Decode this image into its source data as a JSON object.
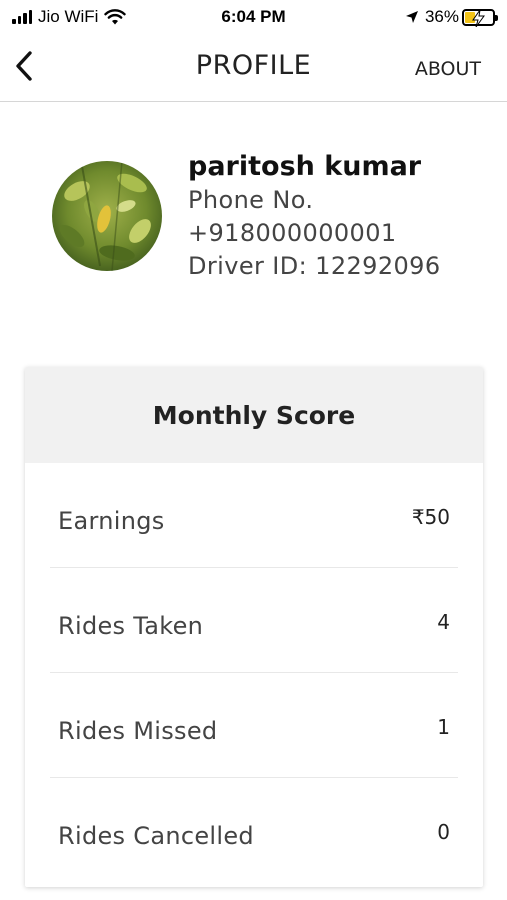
{
  "status_bar": {
    "carrier": "Jio WiFi",
    "time": "6:04 PM",
    "battery_percent": "36%",
    "battery_level": 0.36,
    "battery_color": "#f2c318"
  },
  "nav": {
    "back_icon": "chevron-left-icon",
    "title": "PROFILE",
    "about_label": "ABOUT"
  },
  "profile": {
    "name": "paritosh kumar",
    "phone_label": "Phone No.",
    "phone": "+918000000001",
    "driver_id": "Driver ID: 12292096",
    "avatar_icon": "avatar-photo"
  },
  "score_card": {
    "title": "Monthly Score",
    "rows": [
      {
        "label": "Earnings",
        "value": "₹50"
      },
      {
        "label": "Rides Taken",
        "value": "4"
      },
      {
        "label": "Rides Missed",
        "value": "1"
      },
      {
        "label": "Rides Cancelled",
        "value": "0"
      }
    ]
  }
}
